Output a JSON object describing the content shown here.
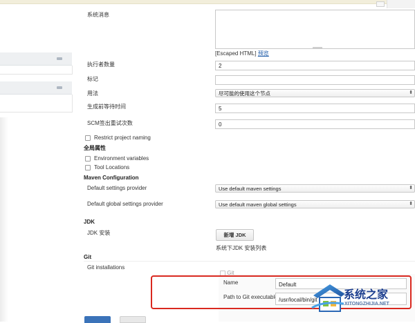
{
  "config": {
    "system_message": {
      "label": "系统消息",
      "value": ""
    },
    "escaped_html_text": "[Escaped HTML]",
    "preview_link": "预览",
    "executors": {
      "label": "执行者数量",
      "value": "2"
    },
    "labels": {
      "label": "标记",
      "value": ""
    },
    "usage": {
      "label": "用法",
      "value": "尽可能的使用这个节点"
    },
    "quiet_period": {
      "label": "生成前等待时间",
      "value": "5"
    },
    "scm_retry": {
      "label": "SCM签出重试次数",
      "value": "0"
    },
    "restrict_naming": {
      "label": "Restrict project naming",
      "checked": false
    }
  },
  "global_properties": {
    "title": "全局属性",
    "items": [
      {
        "label": "Environment variables",
        "checked": false
      },
      {
        "label": "Tool Locations",
        "checked": false
      }
    ]
  },
  "maven": {
    "title": "Maven Configuration",
    "default_settings": {
      "label": "Default settings provider",
      "value": "Use default maven settings"
    },
    "global_settings": {
      "label": "Default global settings provider",
      "value": "Use default maven global settings"
    }
  },
  "jdk": {
    "title": "JDK",
    "install_label": "JDK 安装",
    "add_button": "新增 JDK",
    "hint": "系统下JDK 安装列表"
  },
  "git": {
    "title": "Git",
    "installations_label": "Git installations",
    "item_title": "Git",
    "name": {
      "label": "Name",
      "value": "Default"
    },
    "path": {
      "label": "Path to Git executable",
      "value": "/usr/local/bin/git"
    }
  },
  "watermark": {
    "text": "系统之家",
    "subtext": "XITONGZHIJIA.NET"
  },
  "colors": {
    "accent_button": "#3b73b9",
    "highlight_box": "#d9281f",
    "watermark": "#1d3f8f"
  }
}
